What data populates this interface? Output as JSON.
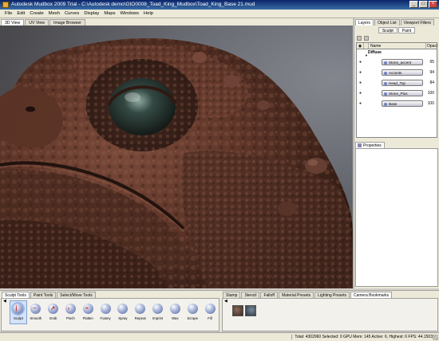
{
  "window": {
    "title": "Autodesk Mudbox 2009 Trial - C:\\Autodesk demo\\GIO0008_Toad_King_Mudbox\\Toad_King_Base 21.mud",
    "icon": "mudbox-app-icon",
    "controls": [
      "minimize",
      "maximize",
      "close"
    ]
  },
  "menubar": {
    "items": [
      "File",
      "Edit",
      "Create",
      "Mesh",
      "Curves",
      "Display",
      "Maps",
      "Windows",
      "Help"
    ]
  },
  "viewport": {
    "tabs": [
      "3D View",
      "UV View",
      "Image Browser"
    ],
    "active_tab": "3D View"
  },
  "right_panel": {
    "tabs": [
      "Layers",
      "Object List",
      "Viewport Filters"
    ],
    "active_tab": "Layers",
    "mode_tabs": [
      "Sculpt",
      "Paint"
    ],
    "active_mode": "Paint",
    "columns": {
      "name": "Name",
      "opacity": "Opaci"
    },
    "group": "Diffuse",
    "layers": [
      {
        "name": "Stone_accent",
        "opacity": "65"
      },
      {
        "name": "Accents",
        "opacity": "94"
      },
      {
        "name": "Head_Top",
        "opacity": "84"
      },
      {
        "name": "Stone_Plus",
        "opacity": "100"
      },
      {
        "name": "Base",
        "opacity": "100"
      }
    ],
    "properties_tab": "Properties"
  },
  "tool_tray": {
    "tabs": [
      "Sculpt Tools",
      "Paint Tools",
      "Select/Move Tools"
    ],
    "active_tab": "Sculpt Tools",
    "tools": [
      "Sculpt",
      "Smooth",
      "Grab",
      "Pinch",
      "Flatten",
      "Foamy",
      "Spray",
      "Repeat",
      "Imprint",
      "Wax",
      "Scrape",
      "Fill"
    ],
    "selected_tool": "Sculpt"
  },
  "stamp_tray": {
    "tabs": [
      "Stamp",
      "Stencil",
      "Falloff",
      "Material Presets",
      "Lighting Presets",
      "Camera Bookmarks"
    ],
    "active_tab": "Camera Bookmarks"
  },
  "status": {
    "text": "Total: 4302960  Selected: 0  GPU Mem: 145  Active: 6, Highest: 6  FPS: 44.1503"
  },
  "colors": {
    "titlebar": "#0a246a",
    "panel": "#ece9d8",
    "selection": "#d6e2f7"
  }
}
